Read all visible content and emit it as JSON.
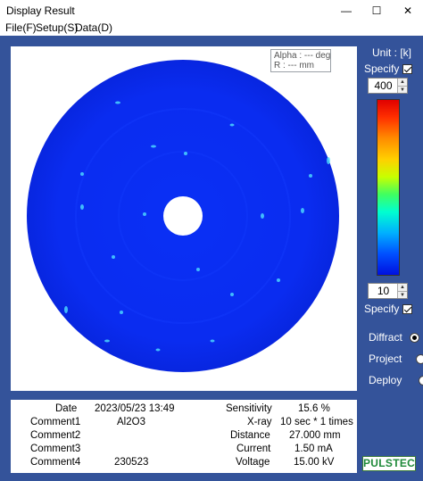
{
  "window": {
    "title": "Display Result",
    "minimize_glyph": "—",
    "maximize_glyph": "☐",
    "close_glyph": "✕"
  },
  "menu": {
    "items": [
      {
        "label": "File(F)"
      },
      {
        "label": "Setup(S)"
      },
      {
        "label": "Data(D)"
      }
    ]
  },
  "readout": {
    "alpha": "Alpha : --- deg",
    "r": "R : --- mm"
  },
  "colorscale": {
    "unit": "Unit : [k]",
    "specify_top_label": "Specify",
    "specify_top_checked": true,
    "max_value": "400",
    "min_value": "10",
    "specify_bottom_label": "Specify",
    "specify_bottom_checked": true
  },
  "modes": {
    "options": [
      {
        "label": "Diffract",
        "selected": true
      },
      {
        "label": "Project",
        "selected": false
      },
      {
        "label": "Deploy",
        "selected": false
      }
    ]
  },
  "info": {
    "date_label": "Date",
    "date_value": "2023/05/23  13:49",
    "comment1_label": "Comment1",
    "comment1_value": "Al2O3",
    "comment2_label": "Comment2",
    "comment2_value": "",
    "comment3_label": "Comment3",
    "comment3_value": "",
    "comment4_label": "Comment4",
    "comment4_value": "230523",
    "sensitivity_label": "Sensitivity",
    "sensitivity_value": "15.6 %",
    "xray_label": "X-ray",
    "xray_value": "10 sec * 1 times",
    "distance_label": "Distance",
    "distance_value": "27.000 mm",
    "current_label": "Current",
    "current_value": "1.50 mA",
    "voltage_label": "Voltage",
    "voltage_value": "15.00 kV"
  },
  "logo": {
    "text": "PULSTEC"
  },
  "colors": {
    "client_background": "#34539a",
    "detector_blue": "#0a2cf0",
    "spot_color": "#4ee0ff"
  }
}
